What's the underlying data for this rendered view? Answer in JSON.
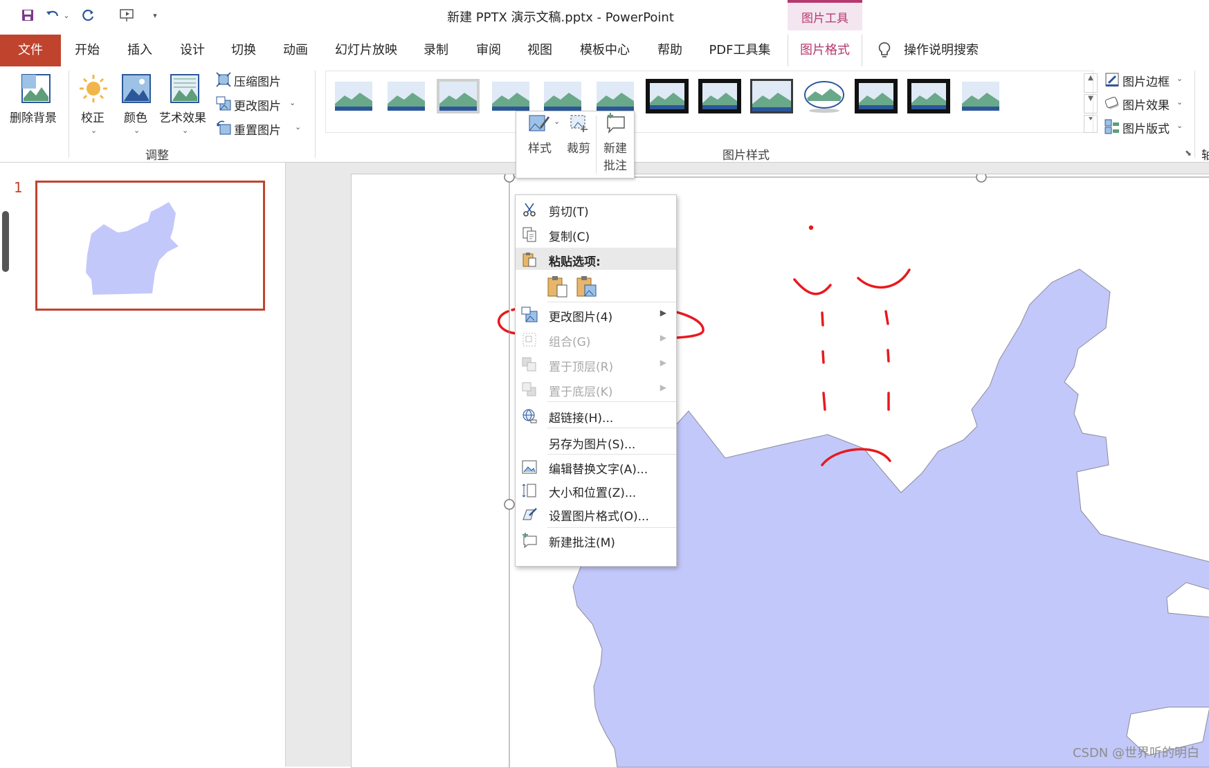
{
  "title_bar": {
    "doc_title": "新建 PPTX 演示文稿.pptx  -  PowerPoint",
    "context_tool": "图片工具"
  },
  "tabs": [
    {
      "id": "file",
      "label": "文件"
    },
    {
      "id": "home",
      "label": "开始"
    },
    {
      "id": "insert",
      "label": "插入"
    },
    {
      "id": "design",
      "label": "设计"
    },
    {
      "id": "transitions",
      "label": "切换"
    },
    {
      "id": "animations",
      "label": "动画"
    },
    {
      "id": "slideshow",
      "label": "幻灯片放映"
    },
    {
      "id": "record",
      "label": "录制"
    },
    {
      "id": "review",
      "label": "审阅"
    },
    {
      "id": "view",
      "label": "视图"
    },
    {
      "id": "templates",
      "label": "模板中心"
    },
    {
      "id": "help",
      "label": "帮助"
    },
    {
      "id": "pdf",
      "label": "PDF工具集"
    },
    {
      "id": "picformat",
      "label": "图片格式"
    }
  ],
  "tell_me": "操作说明搜索",
  "ribbon": {
    "remove_bg": "删除背景",
    "corrections": "校正",
    "color": "颜色",
    "artistic": "艺术效果",
    "compress": "压缩图片",
    "change_pic": "更改图片",
    "reset_pic": "重置图片",
    "group_adjust": "调整",
    "group_styles": "图片样式",
    "pic_border": "图片边框",
    "pic_effects": "图片效果",
    "pic_layout": "图片版式",
    "right_cut": "轴"
  },
  "slides_pane": {
    "slide_number": "1"
  },
  "mini_toolbar": {
    "style": "样式",
    "crop": "裁剪",
    "new_comment_1": "新建",
    "new_comment_2": "批注"
  },
  "context_menu": {
    "cut": "剪切(T)",
    "copy": "复制(C)",
    "paste_options": "粘贴选项:",
    "change_picture": "更改图片(4)",
    "group": "组合(G)",
    "bring_front": "置于顶层(R)",
    "send_back": "置于底层(K)",
    "hyperlink": "超链接(H)...",
    "save_as_picture": "另存为图片(S)...",
    "edit_alt_text": "编辑替换文字(A)...",
    "size_position": "大小和位置(Z)...",
    "format_picture": "设置图片格式(O)...",
    "new_comment": "新建批注(M)"
  },
  "watermark": "CSDN @世界听的明白",
  "colors": {
    "accent": "#c0432d",
    "picture_tools": "#b5396f",
    "map_fill": "#c3c8fa",
    "annotation": "#e8191e"
  }
}
